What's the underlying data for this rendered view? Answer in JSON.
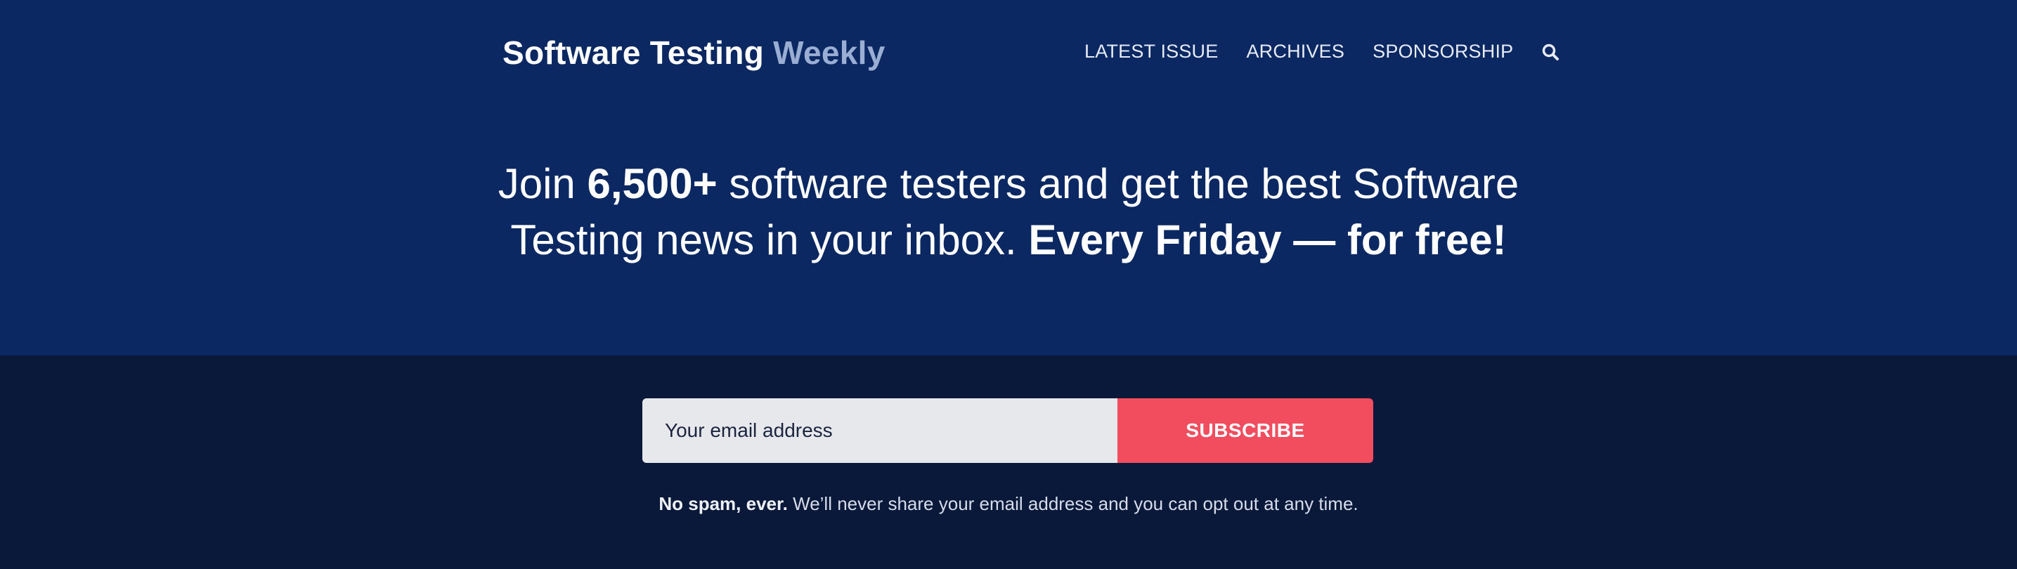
{
  "header": {
    "brand_main": "Software Testing",
    "brand_accent": "Weekly",
    "nav": [
      {
        "label": "LATEST ISSUE"
      },
      {
        "label": "ARCHIVES"
      },
      {
        "label": "SPONSORSHIP"
      }
    ],
    "search_icon": "search-icon"
  },
  "hero": {
    "text_1": "Join ",
    "count": "6,500+",
    "text_2": " software testers and get the best Software Testing news in your inbox. ",
    "emphasis": "Every Friday — for free!"
  },
  "signup": {
    "email_placeholder": "Your email address",
    "button_label": "SUBSCRIBE",
    "note_bold": "No spam, ever.",
    "note_text": " We’ll never share your email address and you can opt out at any time."
  },
  "colors": {
    "hero_bg": "#0b2862",
    "signup_bg": "#0a1939",
    "accent": "#f14d5f",
    "brand_accent": "#9aaed3"
  }
}
